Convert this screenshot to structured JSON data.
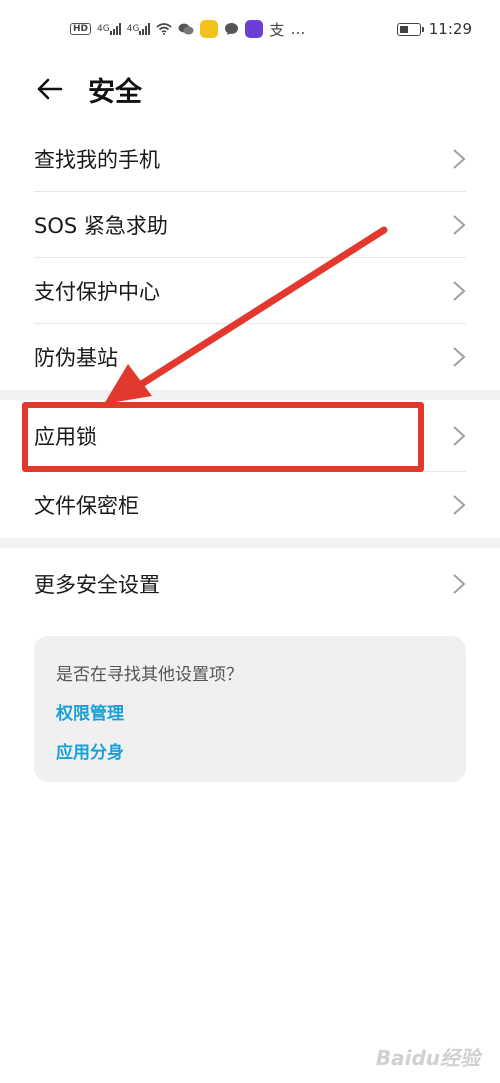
{
  "status_bar": {
    "hd": "HD",
    "sig1": "4G",
    "sig2": "4G",
    "more": "…",
    "alipay": "支",
    "time": "11:29"
  },
  "header": {
    "title": "安全"
  },
  "list": {
    "items": [
      {
        "label": "查找我的手机"
      },
      {
        "label": "SOS 紧急求助"
      },
      {
        "label": "支付保护中心"
      },
      {
        "label": "防伪基站"
      },
      {
        "label": "应用锁"
      },
      {
        "label": "文件保密柜"
      },
      {
        "label": "更多安全设置"
      }
    ]
  },
  "card": {
    "question": "是否在寻找其他设置项？",
    "link1": "权限管理",
    "link2": "应用分身"
  },
  "annotation": {
    "color": "#e2382d"
  },
  "watermark": "Baidu经验"
}
